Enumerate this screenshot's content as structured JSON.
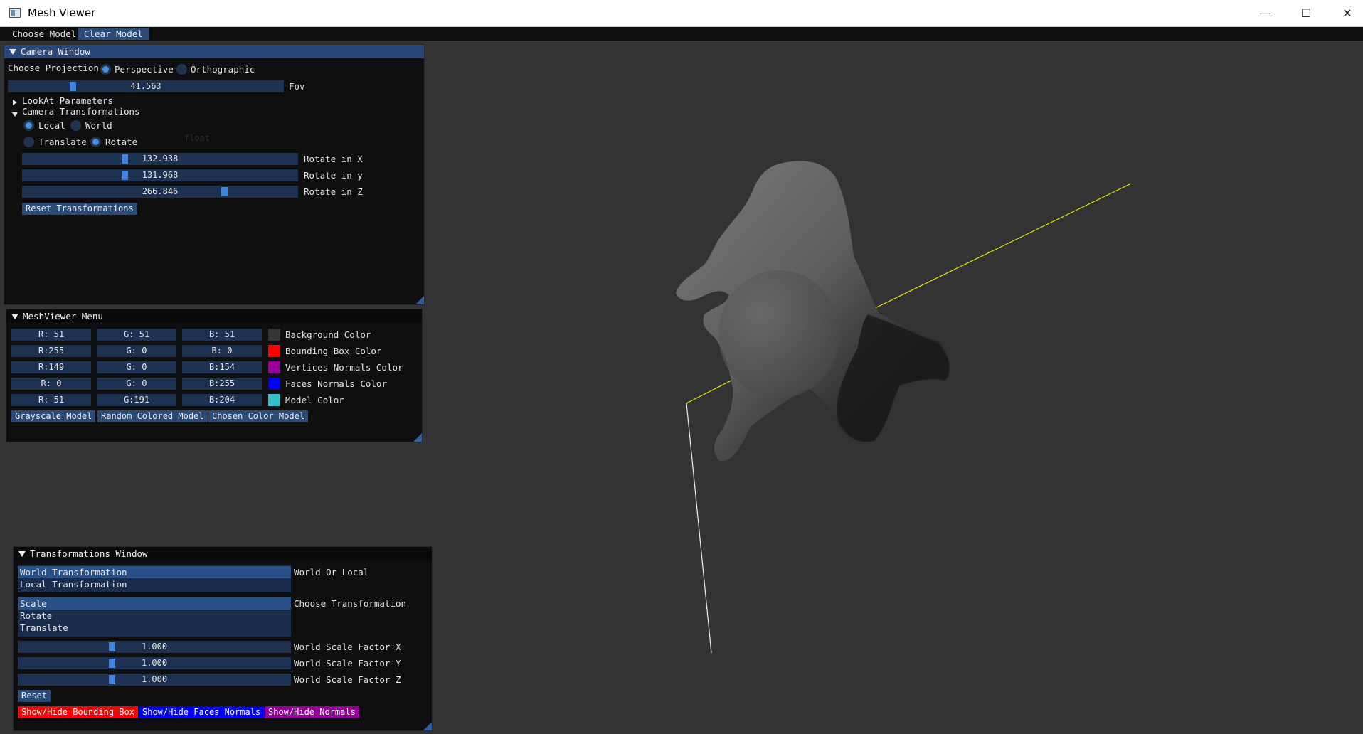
{
  "window": {
    "title": "Mesh Viewer",
    "controls": {
      "minimize": "—",
      "maximize": "☐",
      "close": "✕"
    }
  },
  "menubar": {
    "items": [
      "Choose Model",
      "Clear Model"
    ],
    "active_index": 1
  },
  "camera_window": {
    "title": "Camera Window",
    "projection_label": "Choose Projection",
    "projection_options": [
      "Perspective",
      "Orthographic"
    ],
    "projection_selected": "Perspective",
    "fov": {
      "value": "41.563",
      "label": "Fov",
      "fraction": 0.23
    },
    "lookat_header": "LookAt Parameters",
    "transforms_header": "Camera Transformations",
    "space_options": [
      "Local",
      "World"
    ],
    "space_selected": "Local",
    "mode_options": [
      "Translate",
      "Rotate"
    ],
    "mode_selected": "Rotate",
    "rotations": [
      {
        "value": "132.938",
        "label": "Rotate in X",
        "fraction": 0.37
      },
      {
        "value": "131.968",
        "label": "Rotate in y",
        "fraction": 0.37
      },
      {
        "value": "266.846",
        "label": "Rotate in Z",
        "fraction": 0.74
      }
    ],
    "reset_label": "Reset Transformations",
    "ghost_text": "float"
  },
  "meshviewer_menu": {
    "title": "MeshViewer Menu",
    "rows": [
      {
        "r": "R: 51",
        "g": "G: 51",
        "b": "B: 51",
        "swatch": "#333333",
        "label": "Background Color"
      },
      {
        "r": "R:255",
        "g": "G:  0",
        "b": "B:  0",
        "swatch": "#ff0000",
        "label": "Bounding Box Color"
      },
      {
        "r": "R:149",
        "g": "G:  0",
        "b": "B:154",
        "swatch": "#95009a",
        "label": "Vertices Normals Color"
      },
      {
        "r": "R:  0",
        "g": "G:  0",
        "b": "B:255",
        "swatch": "#0000ff",
        "label": "Faces Normals Color"
      },
      {
        "r": "R: 51",
        "g": "G:191",
        "b": "B:204",
        "swatch": "#33bfcc",
        "label": "Model Color"
      }
    ],
    "buttons": [
      "Grayscale Model",
      "Random Colored Model",
      "Chosen Color Model"
    ]
  },
  "transformations_window": {
    "title": "Transformations Window",
    "space_list": [
      "World Transformation",
      "Local Transformation"
    ],
    "space_selected_index": 0,
    "space_label": "World Or Local",
    "transform_list": [
      "Scale",
      "Rotate",
      "Translate"
    ],
    "transform_selected_index": 0,
    "transform_label": "Choose Transformation",
    "scale_factors": [
      {
        "value": "1.000",
        "label": "World Scale Factor  X",
        "fraction": 0.34
      },
      {
        "value": "1.000",
        "label": "World Scale Factor  Y",
        "fraction": 0.34
      },
      {
        "value": "1.000",
        "label": "World Scale Factor  Z",
        "fraction": 0.34
      }
    ],
    "reset_label": "Reset",
    "toggle_buttons": [
      {
        "label": "Show/Hide Bounding Box",
        "color": "#ff0000"
      },
      {
        "label": "Show/Hide Faces Normals",
        "color": "#0000ff"
      },
      {
        "label": "Show/Hide Normals",
        "color": "#95009a"
      }
    ]
  },
  "colors": {
    "accent": "#3d85e0",
    "title_active": "#29487a",
    "background": "#333333",
    "axis_yellow": "#e6e600",
    "axis_white": "#ffffff"
  }
}
